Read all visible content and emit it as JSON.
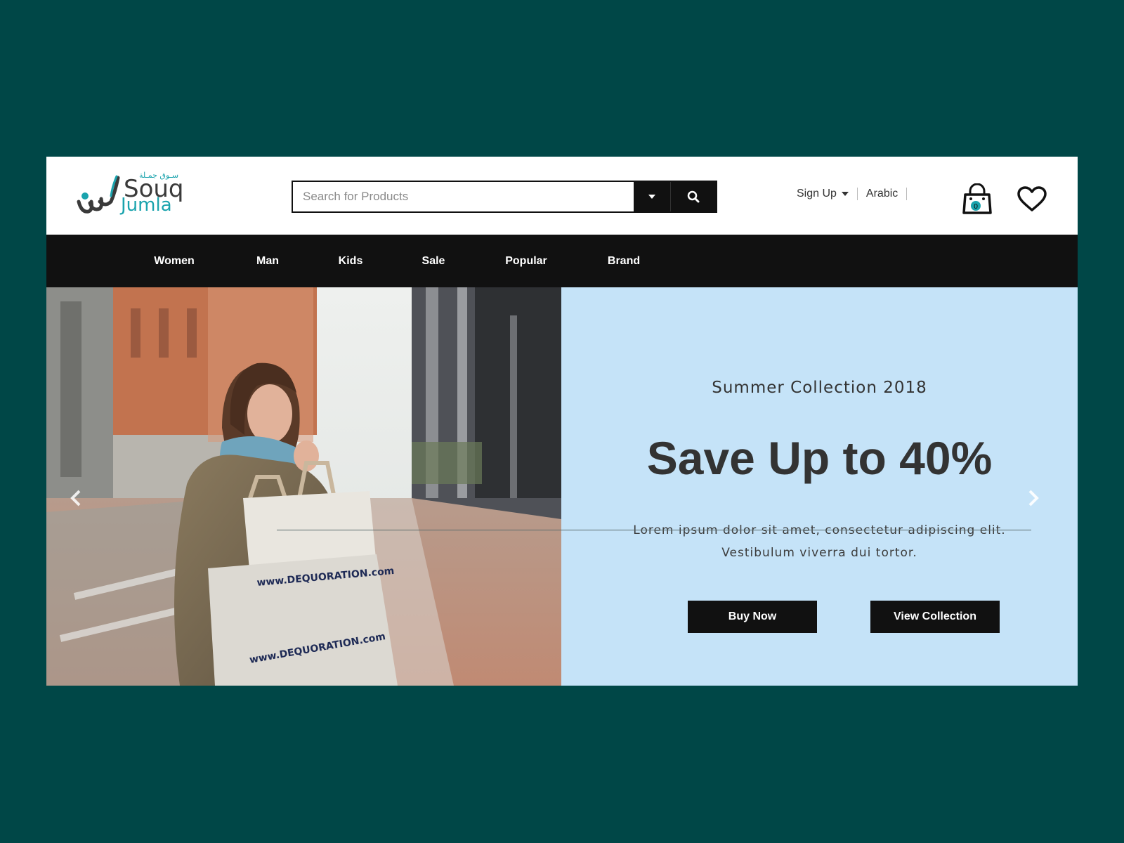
{
  "header": {
    "logo": {
      "arabic": "سـوق جمـلة",
      "souq": "Souq",
      "jumla": "Jumla"
    },
    "search": {
      "placeholder": "Search for Products",
      "value": ""
    },
    "account": {
      "signup_label": "Sign Up",
      "language_label": "Arabic"
    },
    "cart": {
      "count": "0"
    }
  },
  "nav": {
    "items": [
      {
        "label": "Women"
      },
      {
        "label": "Man"
      },
      {
        "label": "Kids"
      },
      {
        "label": "Sale"
      },
      {
        "label": "Popular"
      },
      {
        "label": "Brand"
      }
    ]
  },
  "hero": {
    "subtitle": "Summer Collection 2018",
    "headline": "Save Up to 40%",
    "body_lines": [
      "Lorem ipsum dolor sit amet, consectetur adipiscing elit.",
      "Vestibulum viverra dui tortor."
    ],
    "buttons": {
      "buy_now": "Buy Now",
      "view_collection": "View Collection"
    },
    "bag_print": "www.DEQUORATION.com"
  },
  "colors": {
    "page_background": "#004747",
    "nav_background": "#111111",
    "promo_background": "#c5e3f8",
    "brand_teal": "#1aa3ad",
    "button_background": "#111111"
  },
  "icons": {
    "search": "search-icon",
    "dropdown": "caret-down-icon",
    "cart": "shopping-bag-icon",
    "wishlist": "heart-icon",
    "prev": "chevron-left-icon",
    "next": "chevron-right-icon"
  }
}
